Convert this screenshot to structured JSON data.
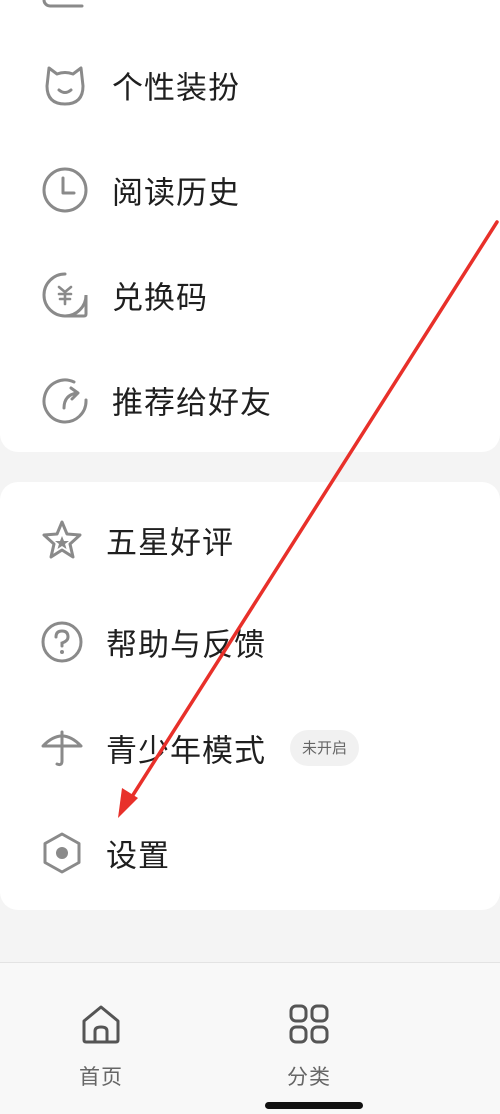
{
  "menu_group_1": {
    "items": [
      {
        "label": "个性装扮",
        "icon": "cat-face-icon"
      },
      {
        "label": "阅读历史",
        "icon": "clock-icon"
      },
      {
        "label": "兑换码",
        "icon": "redeem-code-icon"
      },
      {
        "label": "推荐给好友",
        "icon": "share-arrow-icon"
      }
    ]
  },
  "menu_group_2": {
    "items": [
      {
        "label": "五星好评",
        "icon": "star-icon"
      },
      {
        "label": "帮助与反馈",
        "icon": "help-icon"
      },
      {
        "label": "青少年模式",
        "icon": "umbrella-icon",
        "badge": "未开启"
      },
      {
        "label": "设置",
        "icon": "settings-hexagon-icon"
      }
    ]
  },
  "bottom_nav": {
    "tabs": [
      {
        "label": "首页",
        "icon": "home-icon"
      },
      {
        "label": "分类",
        "icon": "category-grid-icon"
      }
    ]
  },
  "colors": {
    "icon_gray": "#8a8a8a",
    "annotation_arrow": "#e8302a",
    "background": "#f4f4f4",
    "card": "#ffffff"
  }
}
